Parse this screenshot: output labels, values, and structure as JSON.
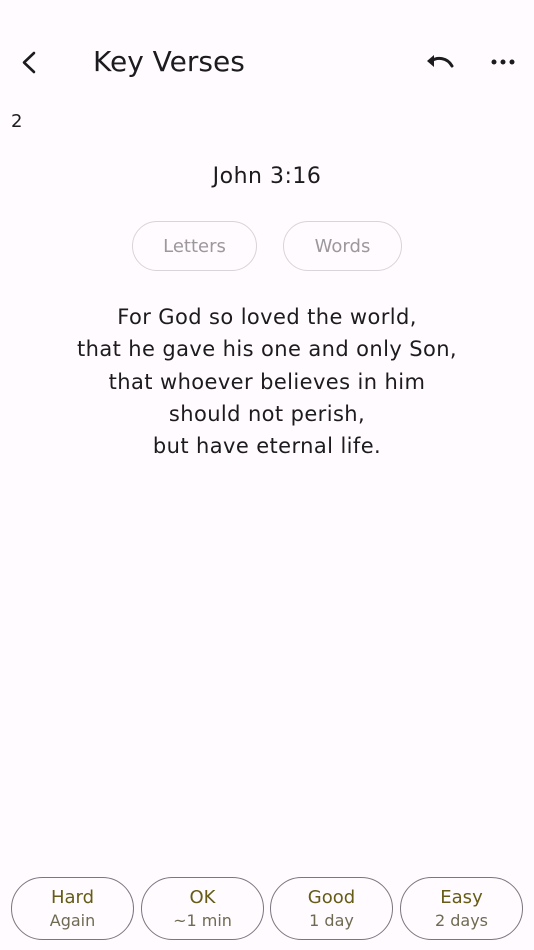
{
  "app_bar": {
    "title": "Key Verses",
    "back_icon": "chevron-left",
    "undo_icon": "undo-arrow",
    "more_icon": "horizontal-ellipsis"
  },
  "review": {
    "counter": "2",
    "reference": "John 3:16",
    "hints": {
      "letters_label": "Letters",
      "words_label": "Words"
    },
    "verse_lines": [
      "For God so loved the world,",
      "that he gave his one and only Son,",
      "that whoever believes in him",
      "should not perish,",
      "but have eternal life."
    ]
  },
  "grades": [
    {
      "label": "Hard",
      "interval": "Again"
    },
    {
      "label": "OK",
      "interval": "~1 min"
    },
    {
      "label": "Good",
      "interval": "1 day"
    },
    {
      "label": "Easy",
      "interval": "2 days"
    }
  ],
  "colors": {
    "background": "#fffbfe",
    "text": "#1c1b1f",
    "hint_text": "#9b989e",
    "grade_label": "#665c17",
    "grade_border": "#7b7680"
  }
}
